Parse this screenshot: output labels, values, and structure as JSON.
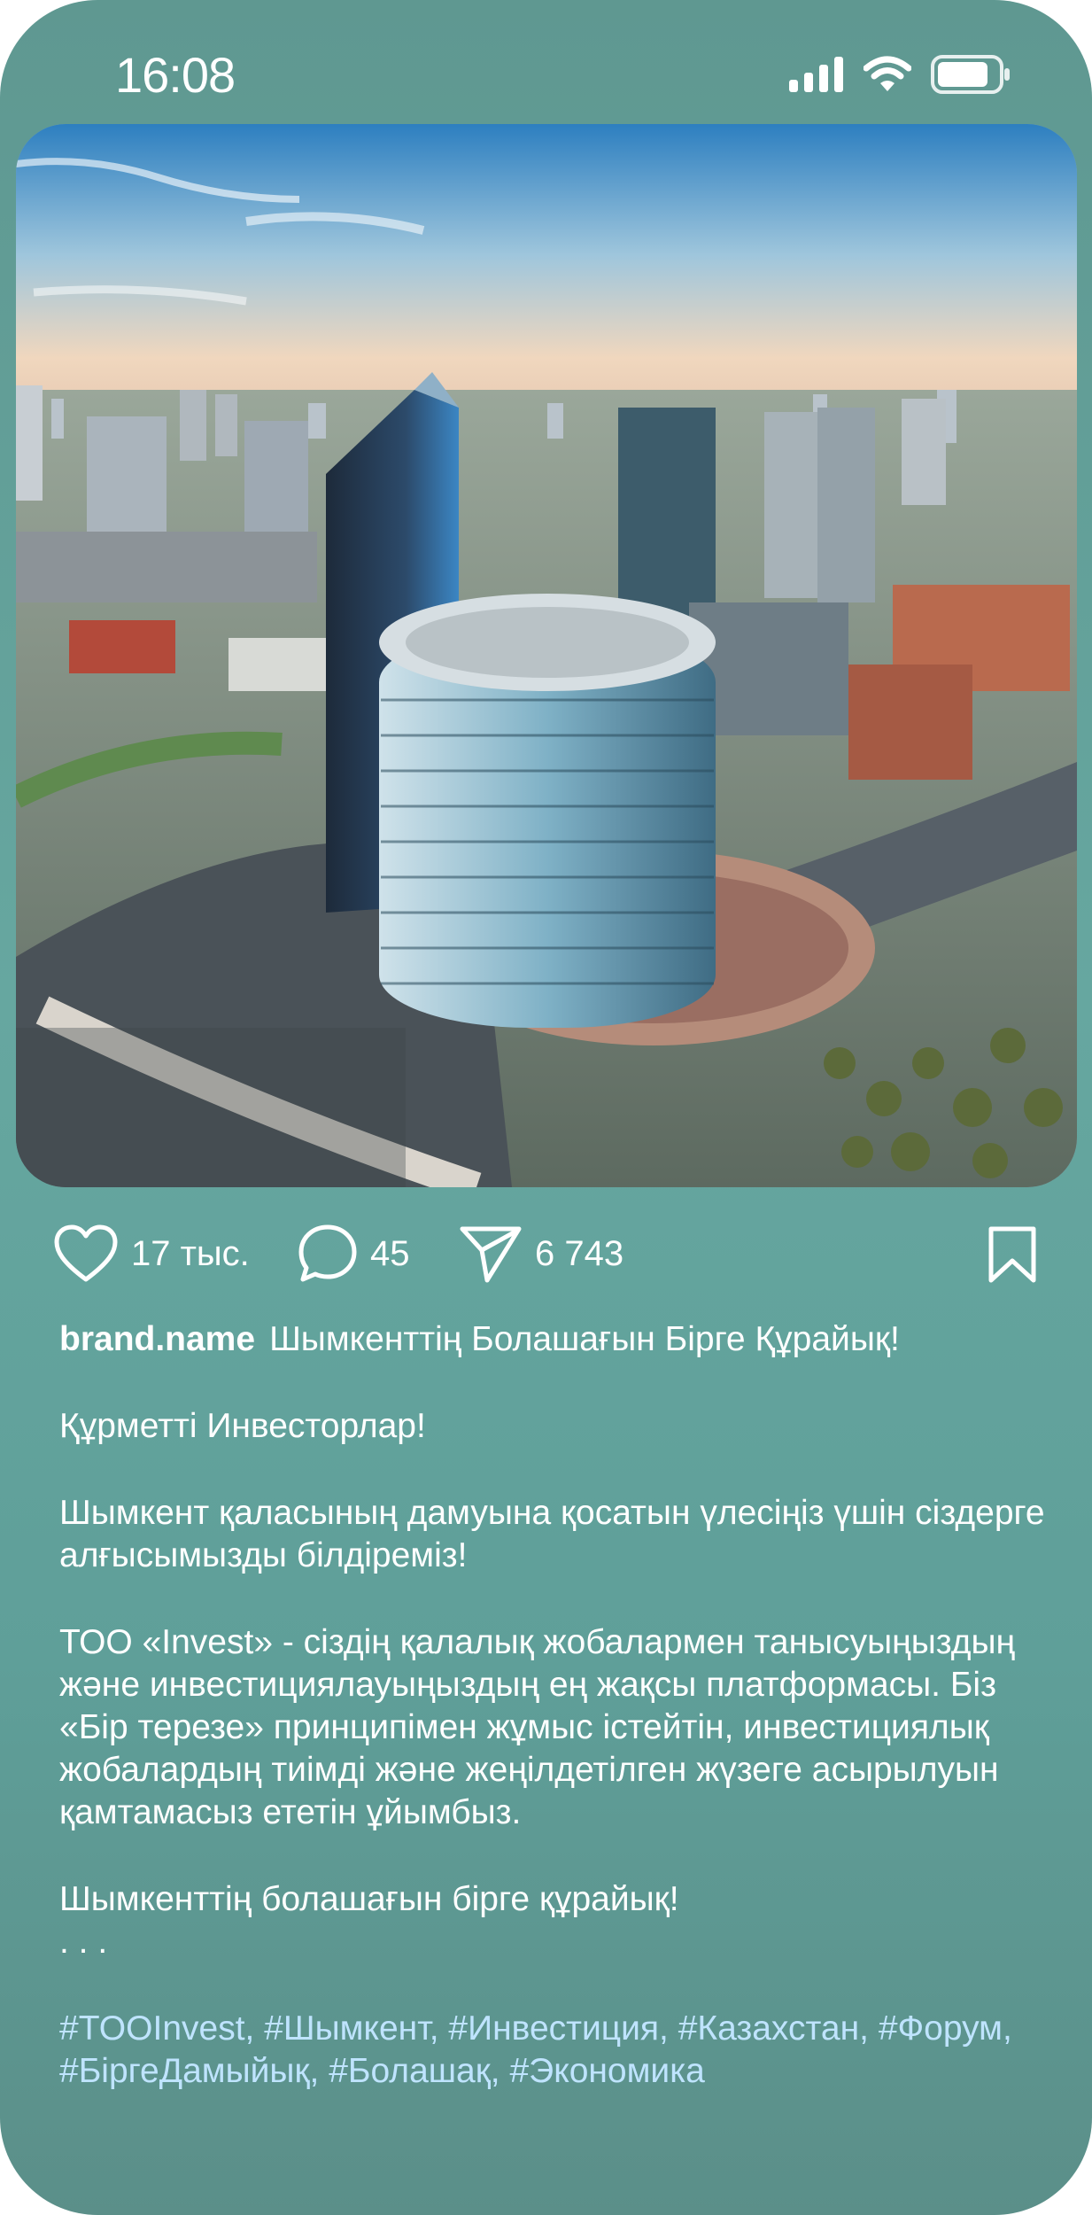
{
  "status": {
    "time": "16:08"
  },
  "post": {
    "likes": "17 тыс.",
    "comments": "45",
    "shares": "6 743",
    "username": "brand.name",
    "headline": "Шымкенттің Болашағын Бірге Құрайық!",
    "paragraphs": [
      "Құрметті Инвесторлар!",
      "Шымкент қаласының дамуына қосатын үлесіңіз үшін сіздерге алғысымызды білдіреміз!",
      "ТОО «Invest» - сіздің қалалық жобалармен танысуыңыздың және инвестициялауыңыздың ең жақсы платформасы. Біз «Бір терезе» принципімен жұмыс істейтін, инвестициялық жобалардың тиімді және жеңілдетілген жүзеге асырылуын қамтамасыз ететін ұйымбыз.",
      "Шымкенттің болашағын бірге құрайық!"
    ],
    "more": ". . .",
    "hashtags": "#TOOInvest, #Шымкент, #Инвестиция, #Казахстан, #Форум, #БіргеДамыйық, #Болашақ, #Экономика"
  },
  "icons": {
    "signal": "cellular-signal-icon",
    "wifi": "wifi-icon",
    "battery": "battery-icon",
    "like": "heart-icon",
    "comment": "comment-bubble-icon",
    "share": "paper-plane-icon",
    "save": "bookmark-icon"
  },
  "colors": {
    "background": "#62a09a",
    "hashtag": "#bfe4ff",
    "text": "#ffffff"
  }
}
